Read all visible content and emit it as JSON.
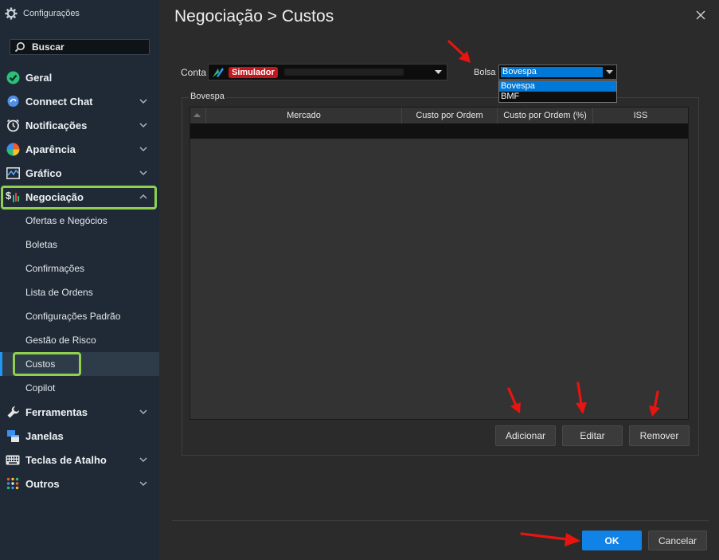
{
  "window": {
    "title": "Configurações"
  },
  "search": {
    "placeholder": "Buscar"
  },
  "sidebar": {
    "items": [
      {
        "label": "Geral",
        "icon": "check-circle-icon"
      },
      {
        "label": "Connect Chat",
        "icon": "chat-icon"
      },
      {
        "label": "Notificações",
        "icon": "alarm-icon"
      },
      {
        "label": "Aparência",
        "icon": "color-wheel-icon"
      },
      {
        "label": "Gráfico",
        "icon": "chart-icon"
      },
      {
        "label": "Negociação",
        "icon": "dollar-chart-icon"
      },
      {
        "label": "Ferramentas",
        "icon": "wrench-icon"
      },
      {
        "label": "Janelas",
        "icon": "windows-icon"
      },
      {
        "label": "Teclas de Atalho",
        "icon": "keyboard-icon"
      },
      {
        "label": "Outros",
        "icon": "dots-grid-icon"
      }
    ],
    "negociacao_sub": [
      "Ofertas e Negócios",
      "Boletas",
      "Confirmações",
      "Lista de Ordens",
      "Configurações Padrão",
      "Gestão de Risco",
      "Custos",
      "Copilot"
    ]
  },
  "page": {
    "title": "Negociação > Custos"
  },
  "form": {
    "conta_label": "Conta",
    "conta_badge": "Simulador",
    "bolsa_label": "Bolsa",
    "bolsa_value": "Bovespa",
    "bolsa_options": [
      "Bovespa",
      "BMF"
    ]
  },
  "group": {
    "title": "Bovespa",
    "columns": [
      "Mercado",
      "Custo por Ordem",
      "Custo por Ordem (%)",
      "ISS"
    ]
  },
  "buttons": {
    "add": "Adicionar",
    "edit": "Editar",
    "remove": "Remover",
    "ok": "OK",
    "cancel": "Cancelar"
  },
  "colors": {
    "accent": "#1283e6",
    "highlight": "#8fd14f",
    "badge": "#c4161c",
    "annotation": "#e8140f"
  }
}
